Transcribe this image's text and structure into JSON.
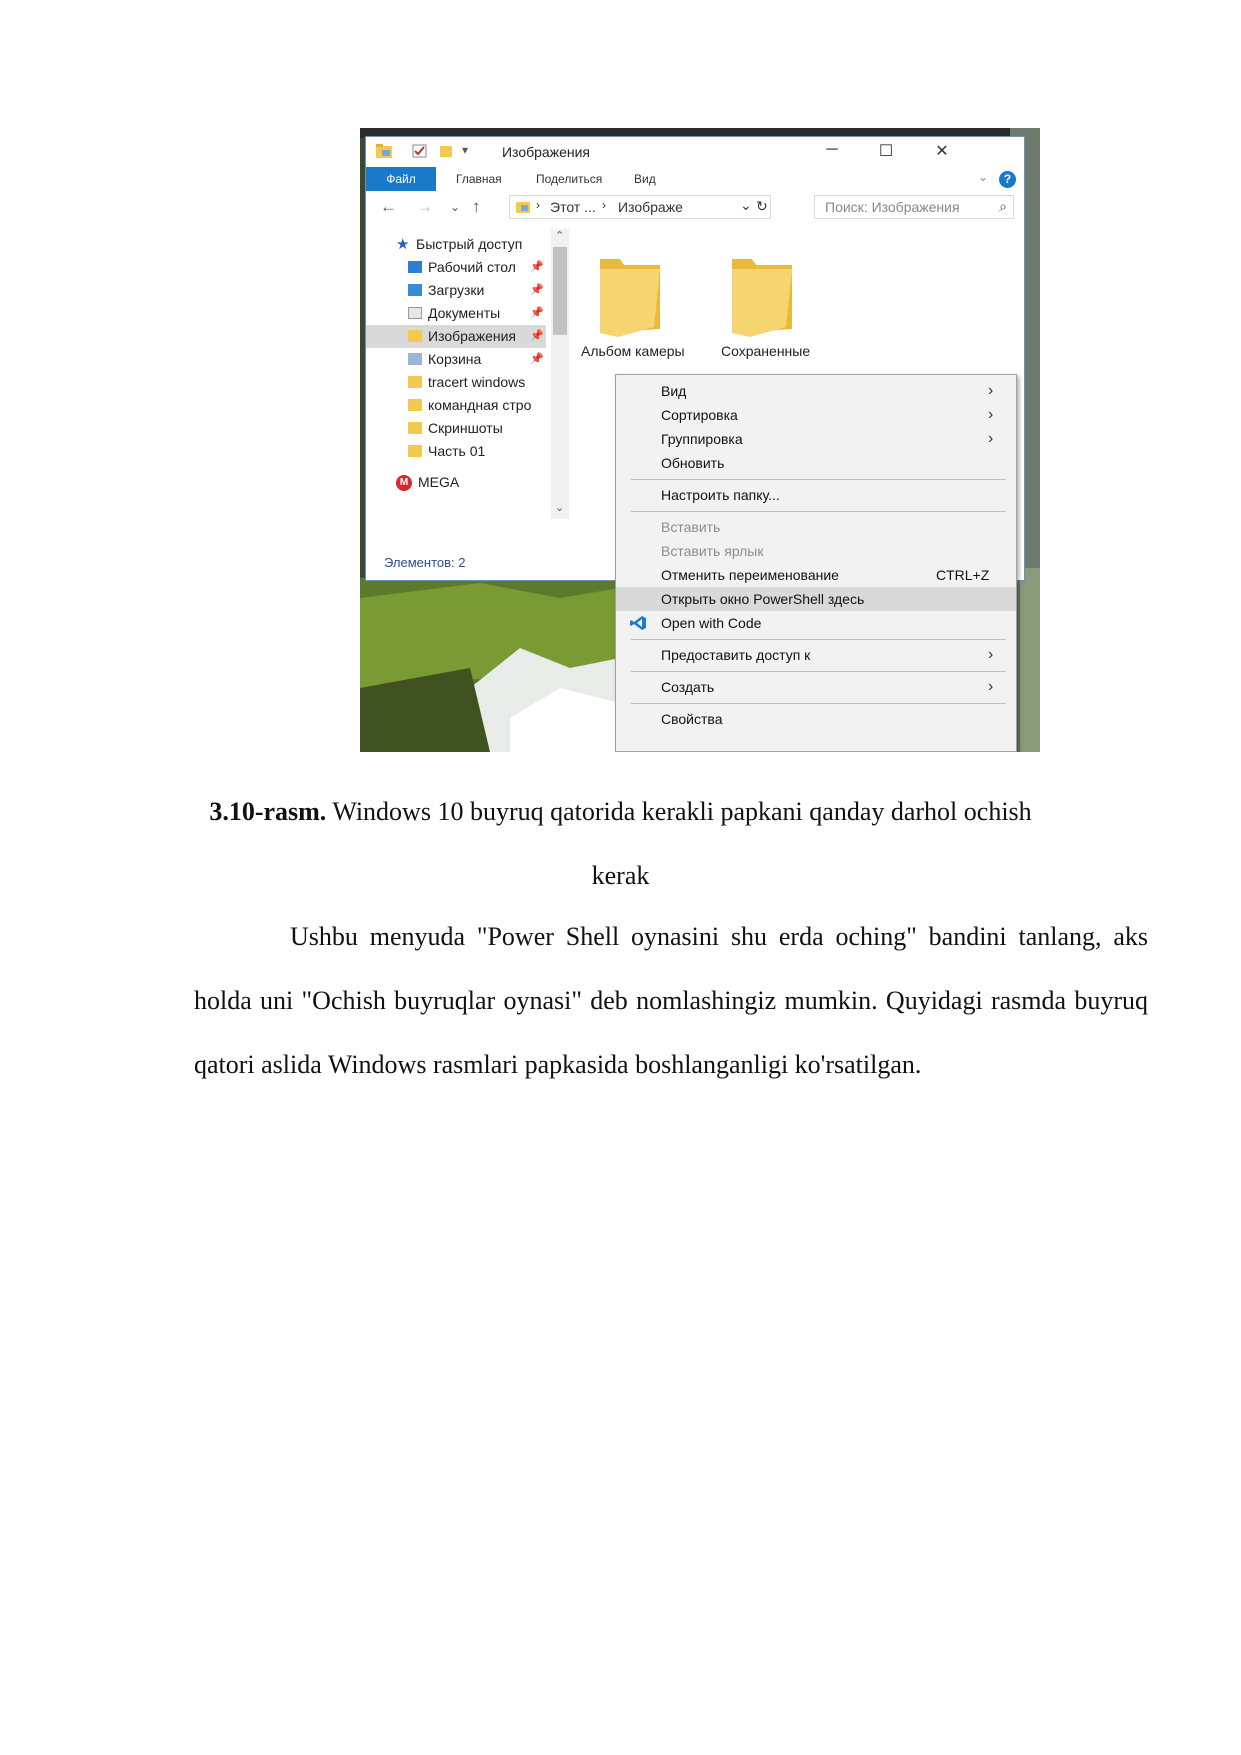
{
  "explorer": {
    "title": "Изображения",
    "ribbon_tabs": [
      "Файл",
      "Главная",
      "Поделиться",
      "Вид"
    ],
    "help_label": "?",
    "breadcrumb": [
      "Этот ...",
      "Изображе"
    ],
    "search_placeholder": "Поиск: Изображения",
    "nav_items": [
      {
        "label": "Быстрый доступ",
        "icon": "star-icon",
        "pinned": false
      },
      {
        "label": "Рабочий стол",
        "icon": "desktop-folder-icon",
        "pinned": true
      },
      {
        "label": "Загрузки",
        "icon": "downloads-folder-icon",
        "pinned": true
      },
      {
        "label": "Документы",
        "icon": "documents-folder-icon",
        "pinned": true
      },
      {
        "label": "Изображения",
        "icon": "pictures-folder-icon",
        "pinned": true,
        "selected": true
      },
      {
        "label": "Корзина",
        "icon": "recycle-bin-icon",
        "pinned": true
      },
      {
        "label": "tracert windows",
        "icon": "folder-icon",
        "pinned": false
      },
      {
        "label": "командная стро",
        "icon": "folder-icon",
        "pinned": false
      },
      {
        "label": "Скриншоты",
        "icon": "folder-icon",
        "pinned": false
      },
      {
        "label": "Часть 01",
        "icon": "folder-icon",
        "pinned": false
      },
      {
        "label": "MEGA",
        "icon": "mega-icon",
        "pinned": false
      }
    ],
    "status": "Элементов: 2",
    "folders": [
      {
        "label": "Альбом камеры"
      },
      {
        "label": "Сохраненные"
      }
    ]
  },
  "context_menu": {
    "items": [
      {
        "label": "Вид",
        "submenu": true
      },
      {
        "label": "Сортировка",
        "submenu": true
      },
      {
        "label": "Группировка",
        "submenu": true
      },
      {
        "label": "Обновить"
      },
      {
        "label": "Настроить папку..."
      },
      {
        "label": "Вставить",
        "disabled": true
      },
      {
        "label": "Вставить ярлык",
        "disabled": true
      },
      {
        "label": "Отменить переименование",
        "shortcut": "CTRL+Z"
      },
      {
        "label": "Открыть окно PowerShell здесь",
        "highlighted": true
      },
      {
        "label": "Open with Code",
        "icon": "vscode-icon"
      },
      {
        "label": "Предоставить доступ к",
        "submenu": true
      },
      {
        "label": "Создать",
        "submenu": true
      },
      {
        "label": "Свойства"
      }
    ]
  },
  "colors": {
    "accent": "#1979ca",
    "folder": "#f3c94f",
    "menu_bg": "#f2f2f2"
  },
  "caption": {
    "number": "3.10-rasm.",
    "text": " Windows 10 buyruq qatorida kerakli papkani qanday darhol ochish kerak"
  },
  "paragraph": "Ushbu menyuda \"Power Shell oynasini shu erda oching\" bandini tanlang, aks holda uni \"Ochish buyruqlar oynasi\" deb nomlashingiz mumkin. Quyidagi rasmda buyruq qatori aslida Windows rasmlari papkasida boshlanganligi ko'rsatilgan."
}
